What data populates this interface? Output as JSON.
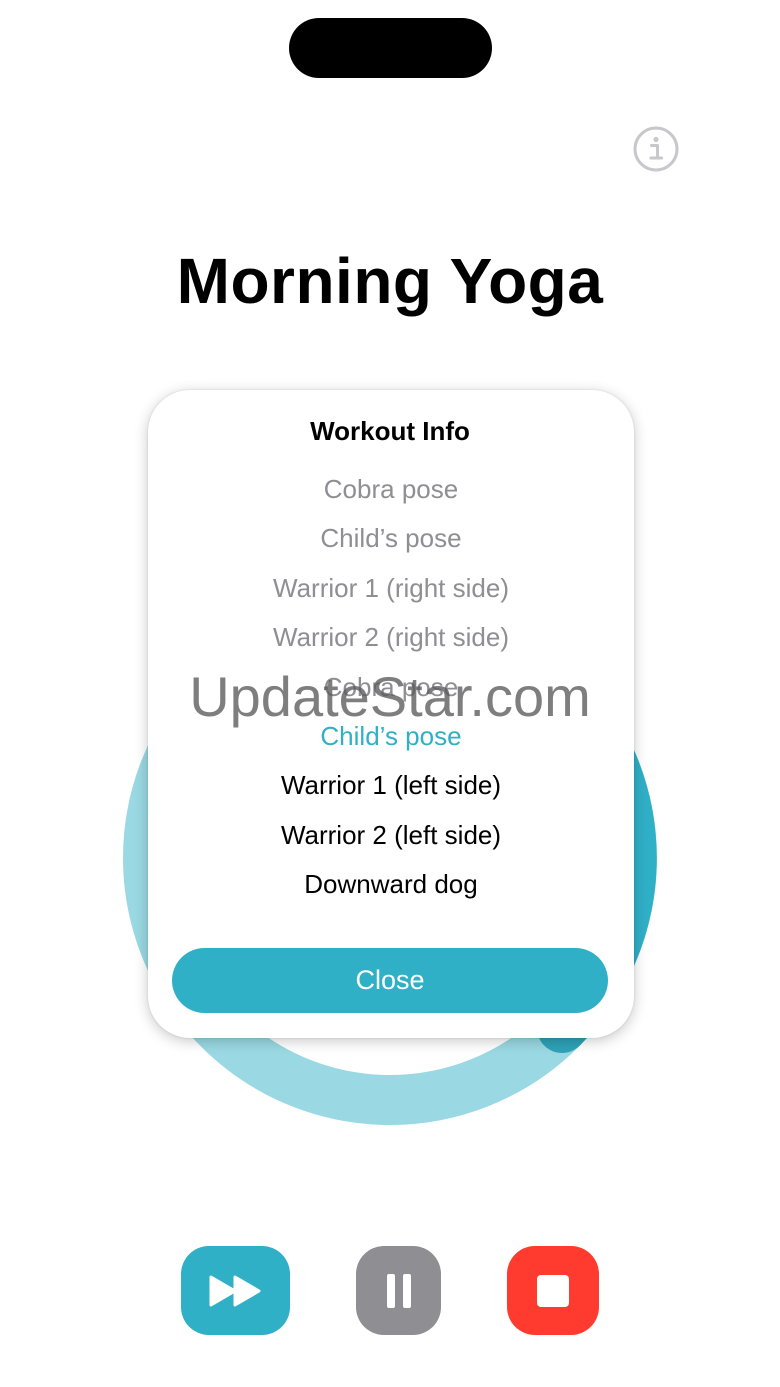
{
  "workout": {
    "title": "Morning Yoga"
  },
  "info_popup": {
    "title": "Workout Info",
    "exercises": [
      {
        "label": "Cobra pose",
        "state": "done"
      },
      {
        "label": "Child’s pose",
        "state": "done"
      },
      {
        "label": "Warrior 1 (right side)",
        "state": "done"
      },
      {
        "label": "Warrior 2 (right side)",
        "state": "done"
      },
      {
        "label": "Cobra pose",
        "state": "done"
      },
      {
        "label": "Child’s pose",
        "state": "current"
      },
      {
        "label": "Warrior 1 (left side)",
        "state": "upcoming"
      },
      {
        "label": "Warrior 2 (left side)",
        "state": "upcoming"
      },
      {
        "label": "Downward dog",
        "state": "upcoming"
      }
    ],
    "close_label": "Close"
  },
  "watermark": "UpdateStar.com",
  "icons": {
    "info": "info-circle-icon",
    "skip": "fast-forward-icon",
    "pause": "pause-icon",
    "stop": "stop-icon"
  },
  "colors": {
    "accent": "#30b0c7",
    "ring_track": "#9ad9e3",
    "pause": "#8e8e93",
    "stop": "#ff3b30",
    "completed_text": "#8e8e93"
  }
}
